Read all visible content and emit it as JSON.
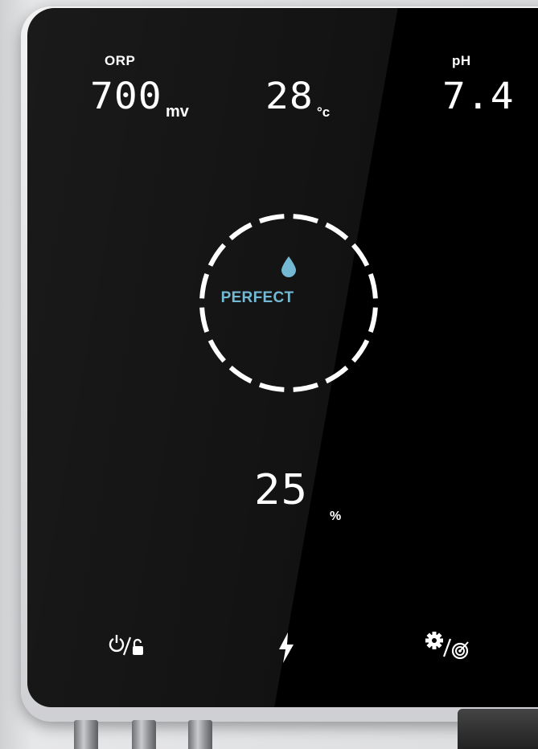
{
  "readings": {
    "orp": {
      "label": "ORP",
      "value": "700",
      "unit": "mv"
    },
    "temperature": {
      "value": "28",
      "unit": "°c"
    },
    "ph": {
      "label": "pH",
      "value": "7.4"
    },
    "percent": {
      "value": "25",
      "unit": "%"
    }
  },
  "status": {
    "text": "PERFECT",
    "color": "#74b9d3",
    "icon": "water-drop-icon"
  },
  "controls": [
    {
      "name": "power-lock-button",
      "icon": "power-unlock-icon"
    },
    {
      "name": "boost-button",
      "icon": "lightning-bolt-icon"
    },
    {
      "name": "settings-target-button",
      "icon": "gear-target-icon"
    }
  ],
  "colors": {
    "panel": "#000000",
    "text": "#ffffff",
    "accent": "#74b9d3"
  }
}
